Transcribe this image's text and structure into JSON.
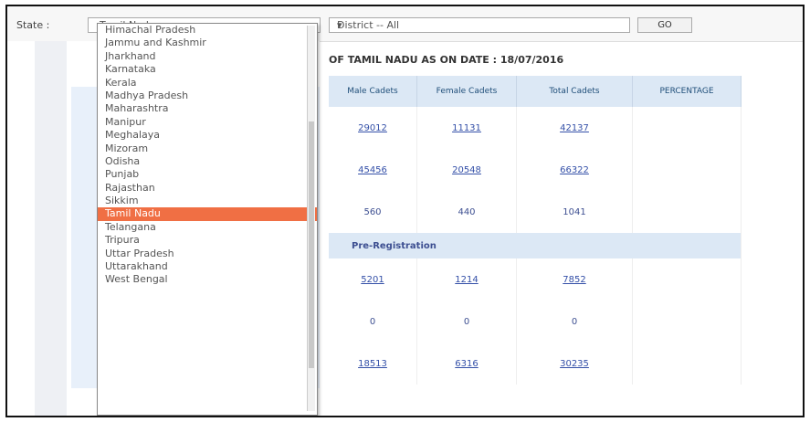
{
  "filters": {
    "state_label": "State :",
    "state_selected": "Tamil Nadu",
    "district_value": "District -- All",
    "go_label": "GO"
  },
  "dropdown": {
    "items": [
      "Himachal Pradesh",
      "Jammu and Kashmir",
      "Jharkhand",
      "Karnataka",
      "Kerala",
      "Madhya Pradesh",
      "Maharashtra",
      "Manipur",
      "Meghalaya",
      "Mizoram",
      "Odisha",
      "Punjab",
      "Rajasthan",
      "Sikkim",
      "Tamil Nadu",
      "Telangana",
      "Tripura",
      "Uttar Pradesh",
      "Uttarakhand",
      "West Bengal"
    ],
    "selected_index": 14,
    "partial_last": "West Bengal"
  },
  "table": {
    "caption": "OF TAMIL NADU AS ON DATE : 18/07/2016",
    "headers": [
      "Male Cadets",
      "Female Cadets",
      "Total Cadets",
      "PERCENTAGE"
    ],
    "rows": [
      [
        "29012",
        "11131",
        "42137",
        ""
      ],
      [
        "45456",
        "20548",
        "66322",
        ""
      ],
      [
        "560",
        "440",
        "1041",
        ""
      ]
    ],
    "section": "Pre-Registration",
    "rows2": [
      [
        "5201",
        "1214",
        "7852",
        ""
      ],
      [
        "0",
        "0",
        "0",
        ""
      ],
      [
        "18513",
        "6316",
        "30235",
        ""
      ]
    ]
  }
}
